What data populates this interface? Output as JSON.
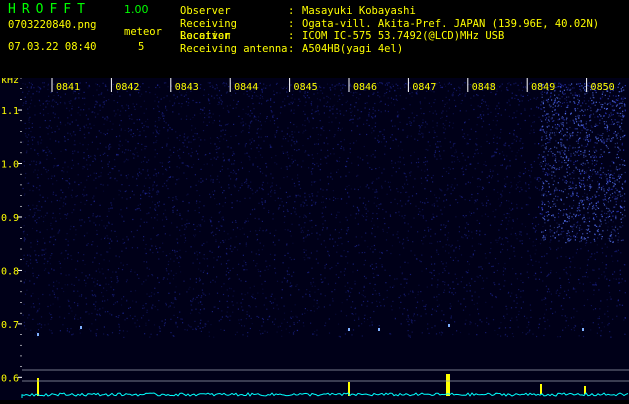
{
  "header": {
    "app_title": "HROFFT",
    "version": "1.00",
    "filename": "0703220840.png",
    "datetime": "07.03.22 08:40",
    "meteor_label": "meteor",
    "meteor_count": "5",
    "info": [
      {
        "key": "Observer",
        "value": "Masayuki Kobayashi"
      },
      {
        "key": "Receiving Location",
        "value": "Ogata-vill. Akita-Pref. JAPAN (139.96E, 40.02N)"
      },
      {
        "key": "Receiver",
        "value": "ICOM IC-575 53.7492(@LCD)MHz USB"
      },
      {
        "key": "Receiving antenna",
        "value": "A504HB(yagi 4el)"
      }
    ],
    "separator": ":"
  },
  "spectrogram": {
    "unit_label": "kHz",
    "time_labels": [
      "0841",
      "0842",
      "0843",
      "0844",
      "0845",
      "0846",
      "0847",
      "0848",
      "0849",
      "0850"
    ],
    "freq_ticks": [
      {
        "label": "1.1",
        "value": 1.1
      },
      {
        "label": "1.0",
        "value": 1.0
      },
      {
        "label": "0.9",
        "value": 0.9
      },
      {
        "label": "0.8",
        "value": 0.8
      },
      {
        "label": "0.7",
        "value": 0.7
      },
      {
        "label": "0.6",
        "value": 0.6
      }
    ],
    "freq_range": [
      0.58,
      1.16
    ],
    "colors": {
      "label": "#ffff00",
      "tick": "#ffffff",
      "background": "#000020",
      "noise": "#2a36c8",
      "meteor": "#ffff00",
      "level": "#00ffff"
    }
  }
}
